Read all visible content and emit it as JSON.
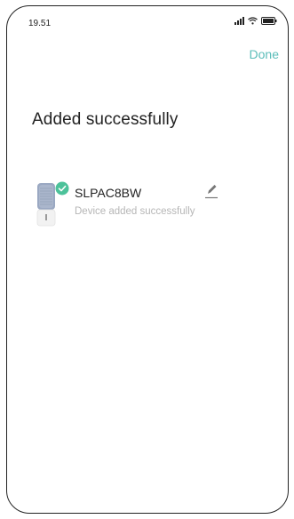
{
  "status_bar": {
    "time": "19.51"
  },
  "header": {
    "done_label": "Done"
  },
  "main": {
    "title": "Added successfully",
    "device": {
      "name": "SLPAC8BW",
      "status": "Device added successfully"
    }
  },
  "colors": {
    "accent": "#5bbdb9",
    "success": "#4cc29a",
    "muted_text": "#b6b6b6",
    "text": "#222222"
  },
  "icons": {
    "status": [
      "signal-icon",
      "wifi-icon",
      "battery-icon"
    ],
    "device_badge": "check-circle-icon",
    "edit": "pencil-icon"
  }
}
